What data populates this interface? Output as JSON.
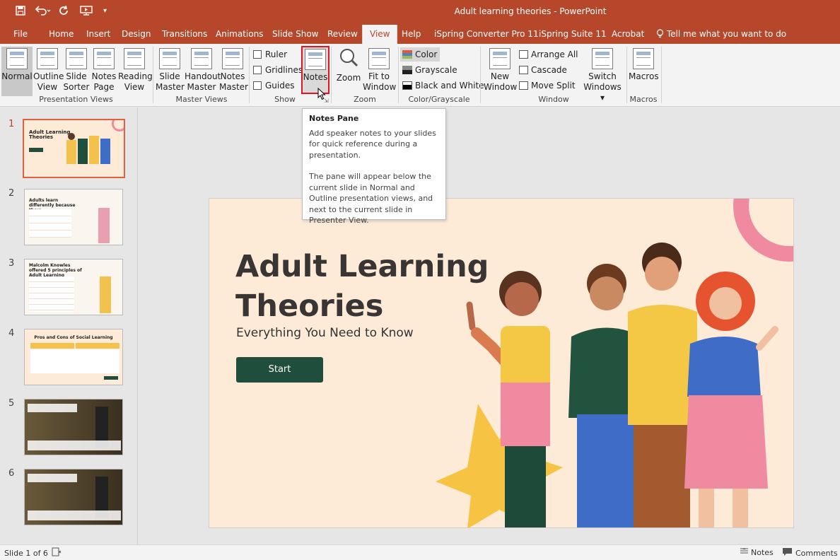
{
  "title_bar": {
    "window_title": "Adult learning theories  -  PowerPoint",
    "quick_access": [
      "save-icon",
      "undo-icon",
      "redo-icon",
      "start-from-beginning-icon",
      "customize-dropdown-icon"
    ]
  },
  "tabs": [
    "File",
    "Home",
    "Insert",
    "Design",
    "Transitions",
    "Animations",
    "Slide Show",
    "Review",
    "View",
    "Help",
    "iSpring Converter Pro 11",
    "iSpring Suite 11",
    "Acrobat"
  ],
  "active_tab": "View",
  "tell_me": "Tell me what you want to do",
  "ribbon": {
    "presentation_views": {
      "label": "Presentation Views",
      "normal": [
        "Normal",
        ""
      ],
      "outline": [
        "Outline",
        "View"
      ],
      "sorter": [
        "Slide",
        "Sorter"
      ],
      "notes_page": [
        "Notes",
        "Page"
      ],
      "reading": [
        "Reading",
        "View"
      ]
    },
    "master_views": {
      "label": "Master Views",
      "slide_master": [
        "Slide",
        "Master"
      ],
      "handout_master": [
        "Handout",
        "Master"
      ],
      "notes_master": [
        "Notes",
        "Master"
      ]
    },
    "show": {
      "label": "Show",
      "ruler": "Ruler",
      "gridlines": "Gridlines",
      "guides": "Guides",
      "notes": "Notes"
    },
    "zoom": {
      "label": "Zoom",
      "zoom": "Zoom",
      "fit": [
        "Fit to",
        "Window"
      ]
    },
    "color": {
      "label": "Color/Grayscale",
      "color": "Color",
      "grayscale": "Grayscale",
      "bw": "Black and White"
    },
    "window": {
      "label": "Window",
      "new_window": [
        "New",
        "Window"
      ],
      "arrange_all": "Arrange All",
      "cascade": "Cascade",
      "move_split": "Move Split",
      "switch": [
        "Switch",
        "Windows ▾"
      ]
    },
    "macros": {
      "label": "Macros",
      "macros": "Macros"
    }
  },
  "tooltip": {
    "title": "Notes Pane",
    "body1": "Add speaker notes to your slides for quick reference during a presentation.",
    "body2": "The pane will appear below the current slide in Normal and Outline presentation views, and next to the current slide in Presenter View."
  },
  "slides": [
    {
      "num": "1",
      "title": "Adult Learning Theories"
    },
    {
      "num": "2",
      "title": "Adults learn differently because they:"
    },
    {
      "num": "3",
      "title": "Malcolm Knowles offered 5 principles of Adult Learning"
    },
    {
      "num": "4",
      "title": "Pros and Cons of Social Learning"
    },
    {
      "num": "5",
      "title": ""
    },
    {
      "num": "6",
      "title": ""
    }
  ],
  "current_slide": {
    "title_line1": "Adult Learning",
    "title_line2": "Theories",
    "subtitle": "Everything You Need to Know",
    "button": "Start"
  },
  "status_bar": {
    "slide_info": "Slide 1 of 6",
    "notes": "Notes",
    "comments": "Comments"
  },
  "colors": {
    "accent": "#b7472a",
    "slide_bg": "#fdebd8",
    "start_button": "#1f4e3d",
    "arc": "#f08aa0"
  }
}
